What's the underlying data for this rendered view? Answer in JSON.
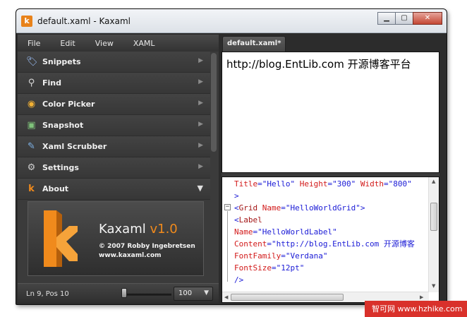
{
  "window": {
    "title": "default.xaml - Kaxaml",
    "app_icon": "k"
  },
  "window_buttons": {
    "minimize": "▁",
    "maximize": "▢",
    "close": "✕"
  },
  "menu": [
    {
      "label": "File"
    },
    {
      "label": "Edit"
    },
    {
      "label": "View"
    },
    {
      "label": "XAML"
    }
  ],
  "plugins": [
    {
      "label": "Snippets",
      "icon": "tag-icon",
      "glyph": "🏷",
      "state": "collapsed"
    },
    {
      "label": "Find",
      "icon": "binoculars-icon",
      "glyph": "⚲",
      "state": "collapsed"
    },
    {
      "label": "Color Picker",
      "icon": "color-wheel-icon",
      "glyph": "◉",
      "state": "collapsed"
    },
    {
      "label": "Snapshot",
      "icon": "snapshot-icon",
      "glyph": "▣",
      "state": "collapsed"
    },
    {
      "label": "Xaml Scrubber",
      "icon": "scrubber-icon",
      "glyph": "✎",
      "state": "collapsed"
    },
    {
      "label": "Settings",
      "icon": "gear-icon",
      "glyph": "⚙",
      "state": "collapsed"
    },
    {
      "label": "About",
      "icon": "kaxaml-icon",
      "glyph": "k",
      "state": "expanded"
    }
  ],
  "about": {
    "title": "Kaxaml",
    "version": "v1.0",
    "copyright": "© 2007 Robby Ingebretsen",
    "website": "www.kaxaml.com"
  },
  "status": {
    "position": "Ln 9, Pos 10",
    "zoom": "100"
  },
  "tab": {
    "label": "default.xaml*"
  },
  "preview": {
    "text": "http://blog.EntLib.com 开源博客平台"
  },
  "code_lines": [
    [
      {
        "t": "Title",
        "c": "c-attr"
      },
      {
        "t": "=",
        "c": "c-punc"
      },
      {
        "t": "\"Hello\"",
        "c": "c-val"
      },
      {
        "t": " Height",
        "c": "c-attr"
      },
      {
        "t": "=",
        "c": "c-punc"
      },
      {
        "t": "\"300\"",
        "c": "c-val"
      },
      {
        "t": " Width",
        "c": "c-attr"
      },
      {
        "t": "=",
        "c": "c-punc"
      },
      {
        "t": "\"800\"",
        "c": "c-val"
      }
    ],
    [
      {
        "t": ">",
        "c": "c-punc"
      }
    ],
    [
      {
        "t": "<",
        "c": "c-punc"
      },
      {
        "t": "Grid",
        "c": "c-tag"
      },
      {
        "t": " Name",
        "c": "c-attr"
      },
      {
        "t": "=",
        "c": "c-punc"
      },
      {
        "t": "\"HelloWorldGrid\"",
        "c": "c-val"
      },
      {
        "t": ">",
        "c": "c-punc"
      }
    ],
    [
      {
        "t": "<",
        "c": "c-punc"
      },
      {
        "t": "Label",
        "c": "c-tag"
      }
    ],
    [
      {
        "t": "Name",
        "c": "c-attr"
      },
      {
        "t": "=",
        "c": "c-punc"
      },
      {
        "t": "\"HelloWorldLabel\"",
        "c": "c-val"
      }
    ],
    [
      {
        "t": "Content",
        "c": "c-attr"
      },
      {
        "t": "=",
        "c": "c-punc"
      },
      {
        "t": "\"http://blog.EntLib.com 开源博客",
        "c": "c-val"
      }
    ],
    [
      {
        "t": "FontFamily",
        "c": "c-attr"
      },
      {
        "t": "=",
        "c": "c-punc"
      },
      {
        "t": "\"Verdana\"",
        "c": "c-val"
      }
    ],
    [
      {
        "t": "FontSize",
        "c": "c-attr"
      },
      {
        "t": "=",
        "c": "c-punc"
      },
      {
        "t": "\"12pt\"",
        "c": "c-val"
      }
    ],
    [
      {
        "t": "/>",
        "c": "c-punc"
      }
    ]
  ],
  "fold_marker": "−",
  "watermark": "智可网 www.hzhike.com",
  "colors": {
    "accent_orange": "#f08a1c",
    "panel_dark": "#3b3b3b",
    "close_red": "#c44733"
  }
}
